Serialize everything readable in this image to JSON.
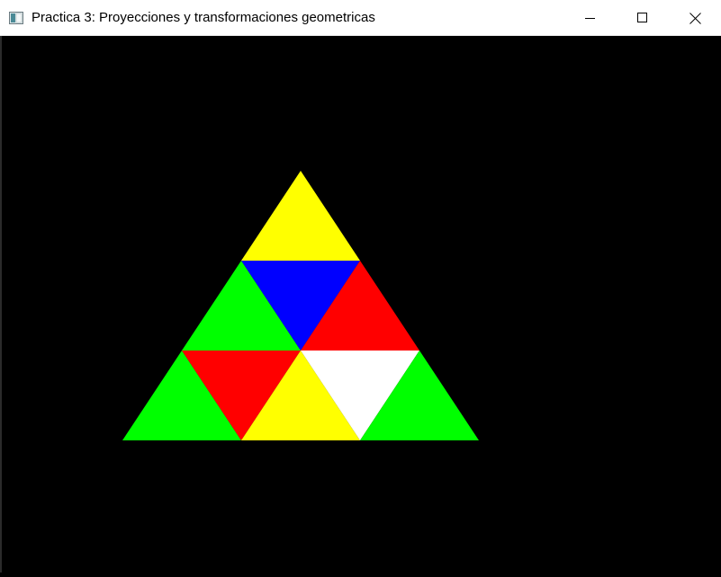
{
  "window": {
    "title": "Practica 3: Proyecciones y transformaciones geometricas",
    "app_icon": "window-app-icon",
    "controls": {
      "minimize_icon": "minimize-icon",
      "maximize_icon": "maximize-icon",
      "close_icon": "close-icon"
    }
  },
  "scene": {
    "background_color": "#000000",
    "triangles": [
      {
        "name": "triangle-top",
        "color": "#ffff00"
      },
      {
        "name": "triangle-middle-left",
        "color": "#00ff00"
      },
      {
        "name": "triangle-middle-center",
        "color": "#0000ff"
      },
      {
        "name": "triangle-middle-right",
        "color": "#ff0000"
      },
      {
        "name": "triangle-bottom-far-left",
        "color": "#00ff00"
      },
      {
        "name": "triangle-bottom-left",
        "color": "#ff0000"
      },
      {
        "name": "triangle-bottom-center",
        "color": "#ffff00"
      },
      {
        "name": "triangle-bottom-right",
        "color": "#ffffff"
      },
      {
        "name": "triangle-bottom-far-right",
        "color": "#00ff00"
      }
    ]
  }
}
